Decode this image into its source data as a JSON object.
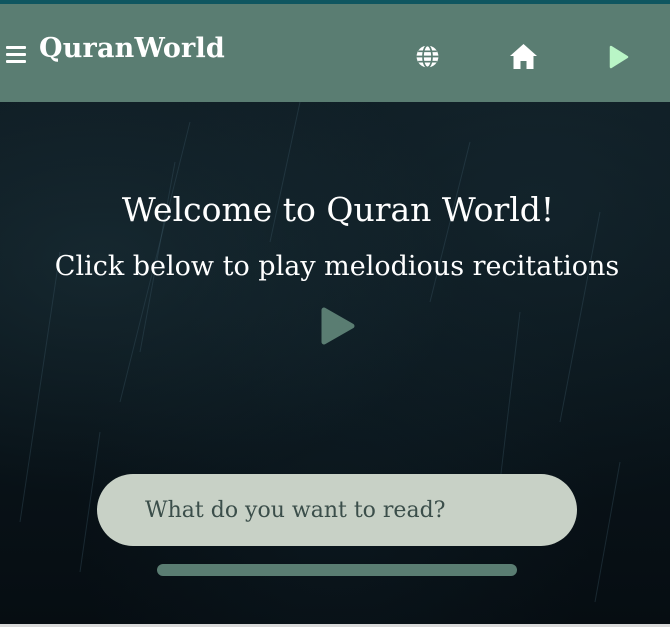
{
  "header": {
    "brand": "QuranWorld",
    "menu_icon": "hamburger-menu-icon",
    "icons": [
      "globe-icon",
      "home-icon",
      "play-icon"
    ]
  },
  "hero": {
    "title": "Welcome to Quran World!",
    "subtitle": "Click below to play melodious recitations",
    "play_icon": "play-icon"
  },
  "search": {
    "placeholder": "What do you want to read?",
    "value": ""
  },
  "colors": {
    "navbar": "#5a7d72",
    "accent_play": "#b9f5c6",
    "search_bg": "#c8d1c6",
    "hero_bg": "#0a151b"
  }
}
